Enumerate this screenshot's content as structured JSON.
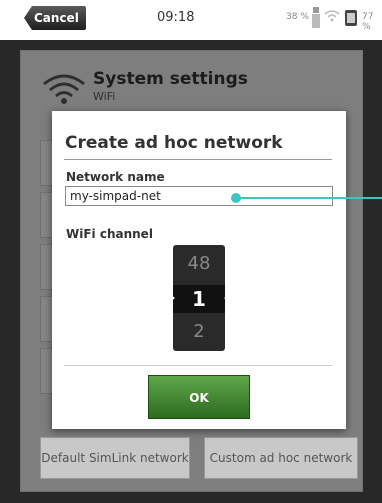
{
  "status_bar": {
    "cancel_label": "Cancel",
    "time": "09:18",
    "battery_percent_left": "38 %",
    "battery_percent_right": "77 %"
  },
  "background": {
    "title": "System settings",
    "subtitle": "WiFi",
    "buttons": [
      {
        "label": "Default SimLink network"
      },
      {
        "label": "Custom ad hoc network"
      }
    ]
  },
  "dialog": {
    "title": "Create ad hoc network",
    "network_name_label": "Network name",
    "network_name_value": "my-simpad-net",
    "wifi_channel_label": "WiFi channel",
    "channel_prev": "48",
    "channel_current": "1",
    "channel_next": "2",
    "ok_label": "OK"
  },
  "colors": {
    "accent": "#3cc6c0",
    "ok_green": "#3f8a2f"
  }
}
